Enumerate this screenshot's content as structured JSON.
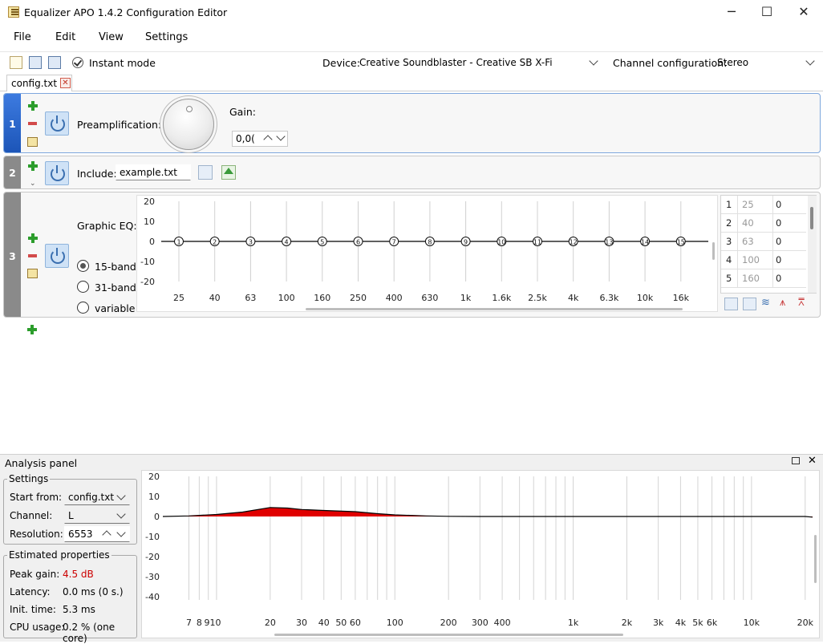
{
  "window": {
    "title": "Equalizer APO 1.4.2 Configuration Editor",
    "minimize": "─",
    "maximize": "☐",
    "close": "✕"
  },
  "menu": [
    "File",
    "Edit",
    "View",
    "Settings"
  ],
  "toolbar": {
    "instant_mode": "Instant mode",
    "device_label": "Device:",
    "device_value": "Creative Soundblaster - Creative SB X-Fi",
    "channel_label": "Channel configuration:",
    "channel_value": "Stereo"
  },
  "tab": {
    "label": "config.txt",
    "close": "✕"
  },
  "filters": [
    {
      "index": "1",
      "label": "Preamplification:",
      "gain_label": "Gain:",
      "gain_value": "0,0("
    },
    {
      "index": "2",
      "label": "Include:",
      "file": "example.txt"
    },
    {
      "index": "3",
      "label": "Graphic EQ:",
      "options": [
        "15-band",
        "31-band",
        "variable"
      ],
      "selected": "15-band"
    }
  ],
  "geq": {
    "y_ticks": [
      "20",
      "10",
      "0",
      "-10",
      "-20"
    ],
    "ylim": [
      -20,
      20
    ],
    "freq_labels": [
      "25",
      "40",
      "63",
      "100",
      "160",
      "250",
      "400",
      "630",
      "1k",
      "1.6k",
      "2.5k",
      "4k",
      "6.3k",
      "10k",
      "16k"
    ],
    "gains": [
      0,
      0,
      0,
      0,
      0,
      0,
      0,
      0,
      0,
      0,
      0,
      0,
      0,
      0,
      0
    ],
    "table": [
      {
        "n": "1",
        "f": "25",
        "g": "0"
      },
      {
        "n": "2",
        "f": "40",
        "g": "0"
      },
      {
        "n": "3",
        "f": "63",
        "g": "0"
      },
      {
        "n": "4",
        "f": "100",
        "g": "0"
      },
      {
        "n": "5",
        "f": "160",
        "g": "0"
      }
    ]
  },
  "analysis": {
    "title": "Analysis panel",
    "settings_title": "Settings",
    "start_from_label": "Start from:",
    "start_from": "config.txt",
    "channel_label": "Channel:",
    "channel": "L",
    "resolution_label": "Resolution:",
    "resolution": "6553",
    "est_title": "Estimated properties",
    "peak_gain_label": "Peak gain:",
    "peak_gain": "4.5 dB",
    "latency_label": "Latency:",
    "latency": "0.0 ms (0 s.)",
    "init_label": "Init. time:",
    "init": "5.3 ms",
    "cpu_label": "CPU usage:",
    "cpu": "0.2 % (one core)",
    "peak_color": "#cc0000"
  },
  "chart_data": {
    "type": "area",
    "title": "",
    "xlabel": "",
    "ylabel": "",
    "x_scale": "log",
    "x_tick_labels": [
      "7",
      "8",
      "910",
      "20",
      "30",
      "40",
      "50",
      "60",
      "100",
      "200",
      "300",
      "400",
      "1k",
      "2k",
      "3k",
      "4k",
      "5k",
      "6k",
      "10k",
      "20k"
    ],
    "y_ticks": [
      "20",
      "10",
      "0",
      "-10",
      "-20",
      "-30",
      "-40"
    ],
    "ylim": [
      -45,
      20
    ],
    "grid": true,
    "series": [
      {
        "x": [
          5,
          7,
          10,
          14,
          20,
          25,
          30,
          40,
          60,
          80,
          100,
          150,
          200,
          300,
          500,
          1000,
          5000,
          20000,
          22000
        ],
        "y": [
          0,
          0.3,
          1,
          2.2,
          4.5,
          4.2,
          3.5,
          3,
          2.4,
          1.4,
          0.8,
          0.3,
          0.1,
          0,
          0,
          0,
          0,
          0,
          -0.3
        ]
      }
    ],
    "fill_color": "#e00000"
  }
}
